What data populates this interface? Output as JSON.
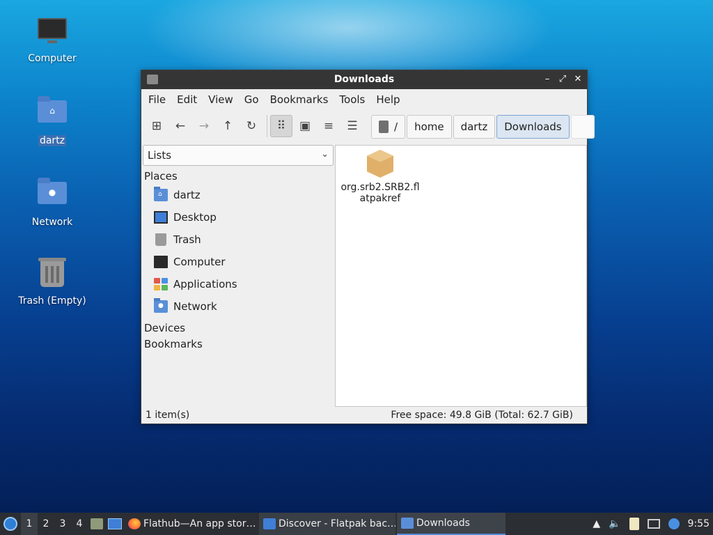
{
  "desktop": {
    "icons": [
      {
        "label": "Computer"
      },
      {
        "label": "dartz"
      },
      {
        "label": "Network"
      },
      {
        "label": "Trash (Empty)"
      }
    ]
  },
  "window": {
    "title": "Downloads",
    "controls": {
      "minimize": "–",
      "maximize": "⤢",
      "close": "✕"
    },
    "menu": [
      "File",
      "Edit",
      "View",
      "Go",
      "Bookmarks",
      "Tools",
      "Help"
    ],
    "toolbar": {
      "new_window_icon": "⊞",
      "back_icon": "←",
      "forward_icon": "→",
      "up_icon": "↑",
      "reload_icon": "↻",
      "icon_view_icon": "⠿",
      "thumb_view_icon": "▣",
      "compact_view_icon": "≡",
      "detail_view_icon": "☰"
    },
    "breadcrumb": [
      "/",
      "home",
      "dartz",
      "Downloads"
    ],
    "side_panel": {
      "mode": "Lists",
      "places_header": "Places",
      "places": [
        {
          "label": "dartz",
          "icon": "home-folder-icon"
        },
        {
          "label": "Desktop",
          "icon": "desktop-icon"
        },
        {
          "label": "Trash",
          "icon": "trash-icon"
        },
        {
          "label": "Computer",
          "icon": "computer-icon"
        },
        {
          "label": "Applications",
          "icon": "applications-icon"
        },
        {
          "label": "Network",
          "icon": "network-folder-icon"
        }
      ],
      "devices_header": "Devices",
      "bookmarks_header": "Bookmarks"
    },
    "files": [
      {
        "name": "org.srb2.SRB2.flatpakref",
        "icon": "package-icon"
      }
    ],
    "status": {
      "items": "1 item(s)",
      "free_space": "Free space: 49.8 GiB (Total: 62.7 GiB)"
    }
  },
  "taskbar": {
    "workspaces": [
      "1",
      "2",
      "3",
      "4"
    ],
    "current_workspace": "1",
    "tasks": [
      {
        "label": "Flathub—An app stor…"
      },
      {
        "label": "Discover - Flatpak bac…"
      },
      {
        "label": "Downloads"
      }
    ],
    "clock": "9:55"
  },
  "colors": {
    "accent": "#4f8ad6",
    "titlebar": "#353535",
    "taskbar": "#2b2e33"
  }
}
